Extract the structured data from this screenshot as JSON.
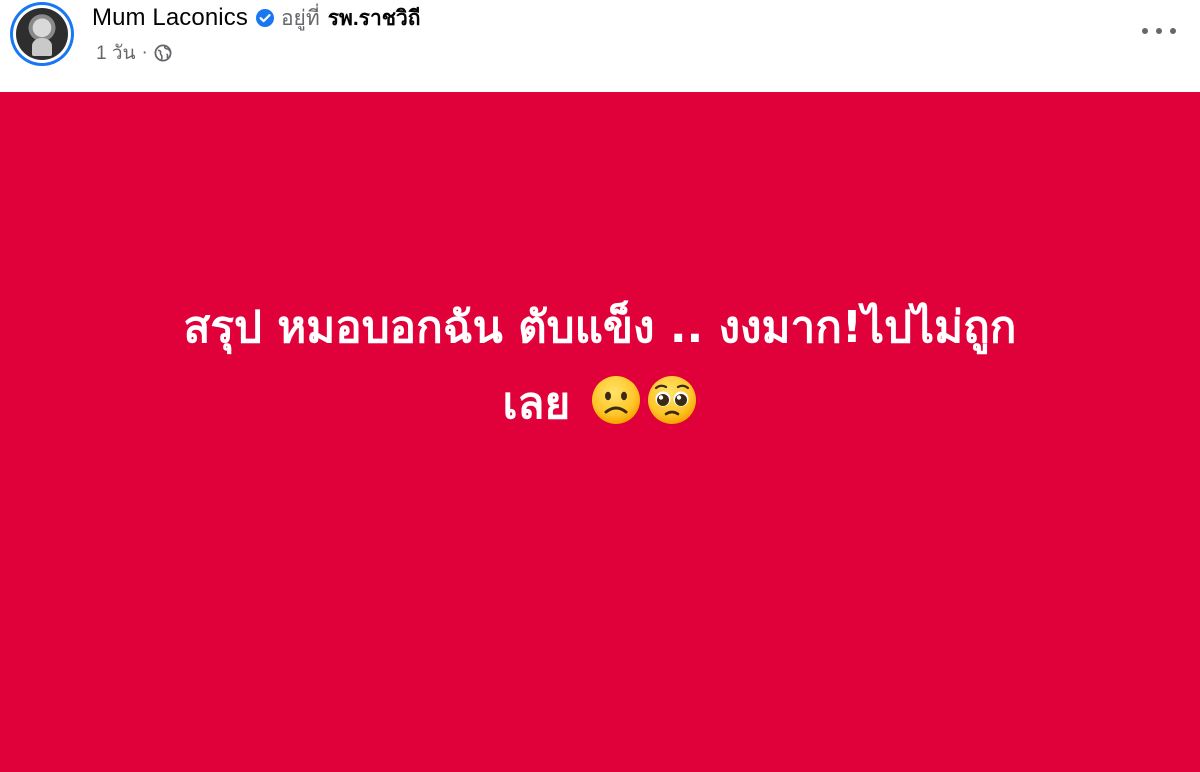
{
  "post": {
    "author_name": "Mum Laconics",
    "at_label": "อยู่ที่",
    "place": "รพ.ราชวิถี",
    "time": "1 วัน",
    "separator": "·",
    "privacy_icon": "globe-icon",
    "verified_icon": "verified-badge-icon",
    "more_icon": "more-options-icon",
    "body": {
      "line1": "สรุป หมอบอกฉัน ตับแข็ง .. งงมาก!ไปไม่ถูก",
      "line2": "เลย",
      "emojis": [
        "slightly-frowning-face-emoji",
        "pleading-face-emoji"
      ]
    },
    "background_color": "#e0003a"
  },
  "colors": {
    "verified": "#1877f2",
    "secondary_text": "#65676b",
    "primary_text": "#050505"
  }
}
